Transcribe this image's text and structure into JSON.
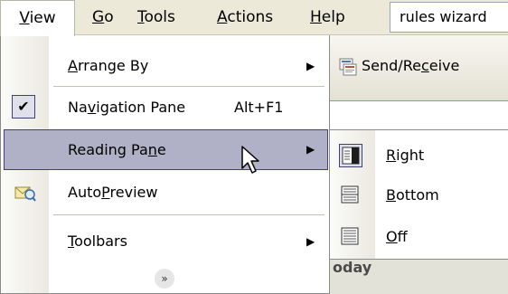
{
  "menubar": {
    "items": [
      {
        "label": "View",
        "underline": "V",
        "rest": "iew"
      },
      {
        "label": "Go",
        "underline": "G",
        "rest": "o"
      },
      {
        "label": "Tools",
        "underline": "T",
        "rest": "ools"
      },
      {
        "label": "Actions",
        "underline": "A",
        "rest": "ctions"
      },
      {
        "label": "Help",
        "underline": "H",
        "rest": "elp"
      }
    ],
    "help_search": "rules wizard"
  },
  "toolbar": {
    "send_receive": {
      "pre": "Send/Re",
      "underline": "c",
      "post": "eive"
    }
  },
  "today_label": "oday",
  "view_menu": {
    "arrange_by": {
      "underline": "A",
      "rest": "rrange By"
    },
    "navigation_pane": {
      "pre": "Na",
      "underline": "v",
      "post": "igation Pane",
      "shortcut": "Alt+F1",
      "checked": true
    },
    "reading_pane": {
      "pre": "Reading Pa",
      "underline": "n",
      "post": "e"
    },
    "autopreview": {
      "pre": "Auto",
      "underline": "P",
      "post": "review"
    },
    "toolbars": {
      "underline": "T",
      "rest": "oolbars"
    },
    "expand_glyph": "»"
  },
  "reading_pane_submenu": {
    "items": [
      {
        "underline": "R",
        "rest": "ight",
        "selected": true
      },
      {
        "underline": "B",
        "rest": "ottom",
        "selected": false
      },
      {
        "underline": "O",
        "rest": "ff",
        "selected": false
      }
    ]
  },
  "glyphs": {
    "submenu_arrow": "▶",
    "check": "✔"
  },
  "colors": {
    "highlight": "#b0b0c6",
    "highlight_border": "#3f3f7a",
    "menubar": "#ece9d8"
  }
}
